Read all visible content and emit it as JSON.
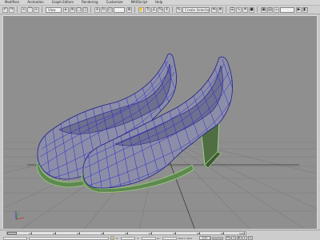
{
  "menu": [
    "Modifiers",
    "Animation",
    "Graph Editors",
    "Rendering",
    "Customize",
    "MAXScript",
    "Help"
  ],
  "toolbar": {
    "selection_filter": "View",
    "named_selection": "Create Selection Se"
  },
  "viewport": {
    "description_hidden": "",
    "shoe_color": "#8c8ea8",
    "wire_color": "#2a2acb",
    "sole_color": "#6e9a5e",
    "background": "#8f8f8f",
    "grid_color": "#7a7a7a"
  },
  "timeline": {
    "ticks": [
      "10",
      "20",
      "30",
      "40",
      "50",
      "60",
      "70",
      "80",
      "90",
      "100"
    ]
  },
  "status": {
    "coord_x": "X:",
    "coord_y": "Y:",
    "coord_z": "Z:",
    "grid_label": "Grid = 10,0",
    "autokey_label": "Auto Key",
    "selected_label": "Selected"
  }
}
